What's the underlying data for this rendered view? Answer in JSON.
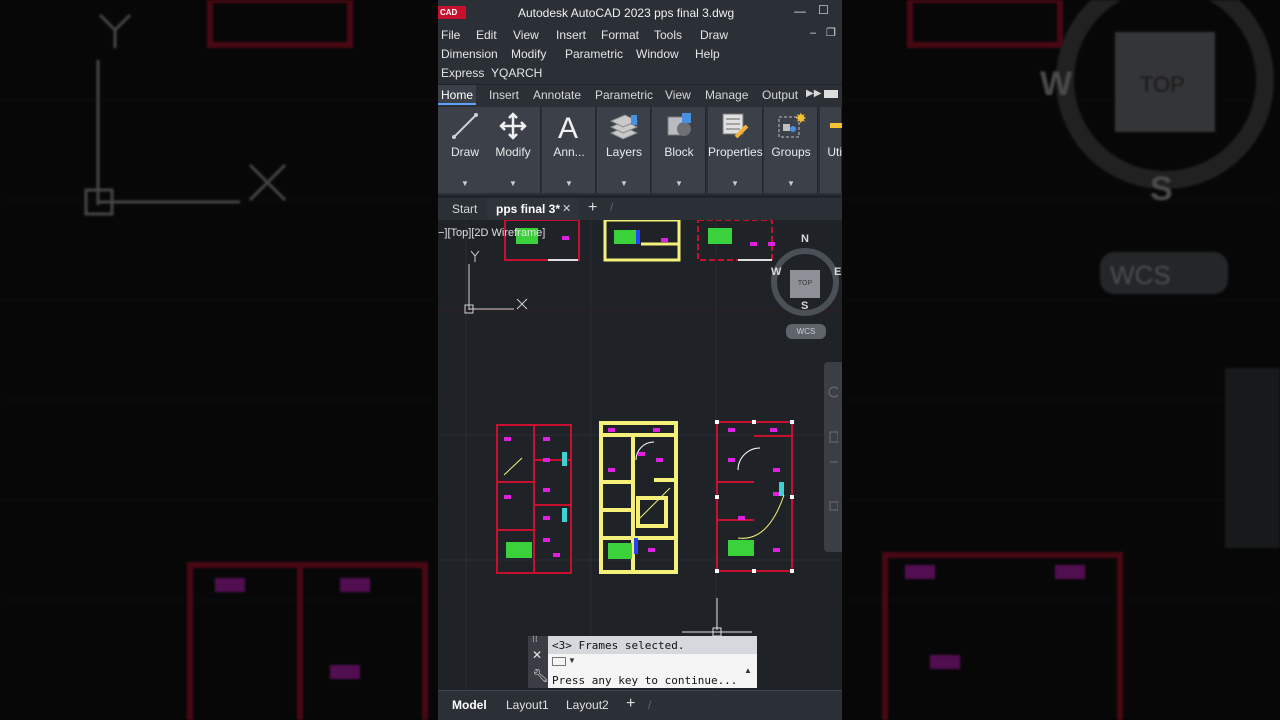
{
  "window": {
    "app_badge": "CAD",
    "title": "Autodesk AutoCAD 2023    pps final 3.dwg",
    "minimize_icon": "minimize-icon",
    "maximize_icon": "maximize-icon"
  },
  "menu": {
    "row1": [
      "File",
      "Edit",
      "View",
      "Insert",
      "Format",
      "Tools",
      "Draw"
    ],
    "row2": [
      "Dimension",
      "Modify",
      "Parametric",
      "Window",
      "Help"
    ],
    "row3": [
      "Express",
      "YQARCH"
    ]
  },
  "ribbon_tabs": [
    "Home",
    "Insert",
    "Annotate",
    "Parametric",
    "View",
    "Manage",
    "Output"
  ],
  "ribbon_active_tab": "Home",
  "ribbon_panels": [
    {
      "label": "Draw",
      "icon": "line-icon"
    },
    {
      "label": "Modify",
      "icon": "move-icon"
    },
    {
      "label": "Ann...",
      "icon": "text-icon"
    },
    {
      "label": "Layers",
      "icon": "layers-icon"
    },
    {
      "label": "Block",
      "icon": "block-icon"
    },
    {
      "label": "Properties",
      "icon": "properties-icon"
    },
    {
      "label": "Groups",
      "icon": "groups-icon"
    },
    {
      "label": "Uti",
      "icon": "utilities-icon"
    }
  ],
  "doc_tabs": {
    "start": "Start",
    "active_file": "pps final 3*",
    "close_glyph": "✕",
    "new_glyph": "+"
  },
  "viewport": {
    "label": "−][Top][2D Wireframe]",
    "ucs_x": "X",
    "ucs_y": "Y",
    "viewcube": {
      "north": "N",
      "south": "S",
      "west": "W",
      "east": "E",
      "face": "TOP"
    },
    "wcs": "WCS"
  },
  "command_line": {
    "history": "<3> Frames selected.",
    "prompt": "Press any key to continue..."
  },
  "layout_tabs": [
    "Model",
    "Layout1",
    "Layout2"
  ],
  "layout_add": "+",
  "colors": {
    "wall_red": "#c8102e",
    "frame_yellow": "#f5f07a",
    "furniture_magenta": "#e020e0",
    "stair_green": "#3ad13a",
    "door_cyan": "#40d0d0"
  }
}
